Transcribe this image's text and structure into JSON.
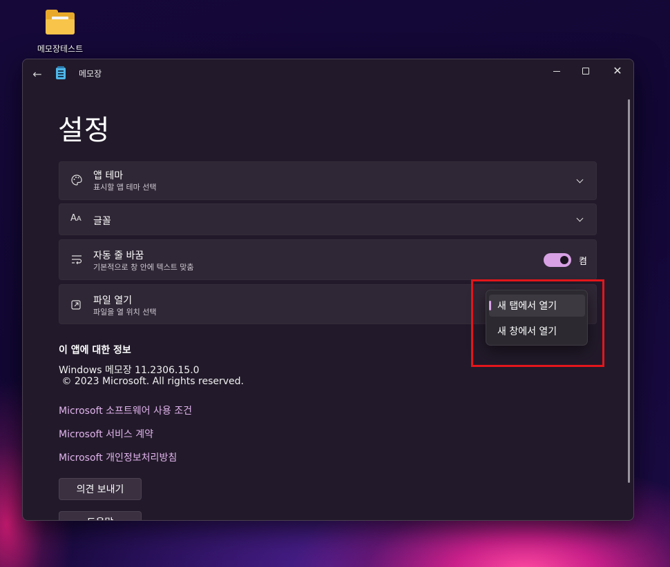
{
  "desktop": {
    "icon_label": "메모장테스트"
  },
  "window": {
    "app_title": "메모장"
  },
  "settings": {
    "page_title": "설정",
    "app_theme": {
      "title": "앱 테마",
      "subtitle": "표시할 앱 테마 선택"
    },
    "font": {
      "title": "글꼴"
    },
    "word_wrap": {
      "title": "자동 줄 바꿈",
      "subtitle": "기본적으로 창 안에 텍스트 맞춤",
      "state_label": "켬",
      "enabled": true
    },
    "file_open": {
      "title": "파일 열기",
      "subtitle": "파일을 열 위치 선택"
    }
  },
  "dropdown": {
    "options": [
      "새 탭에서 열기",
      "새 창에서 열기"
    ],
    "selected": "새 탭에서 열기"
  },
  "about": {
    "heading": "이 앱에 대한 정보",
    "version": "Windows 메모장 11.2306.15.0",
    "copyright": " © 2023 Microsoft. All rights reserved.",
    "links": [
      "Microsoft 소프트웨어 사용 조건",
      "Microsoft 서비스 계약",
      "Microsoft 개인정보처리방침"
    ],
    "feedback_button": "의견 보내기",
    "help_button": "도움말"
  },
  "colors": {
    "accent": "#d9a2ea",
    "highlight_box": "#e3161b",
    "window_bg": "#221a2a"
  }
}
